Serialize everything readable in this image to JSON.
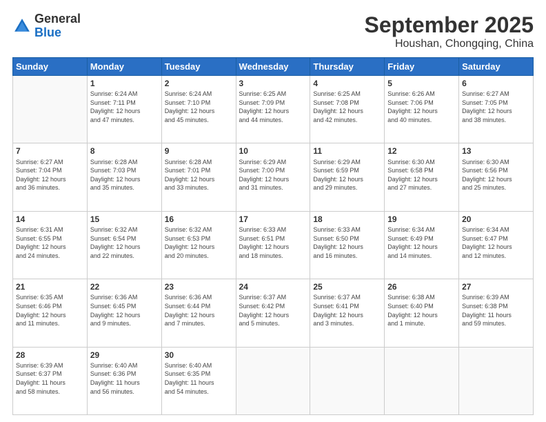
{
  "header": {
    "logo_line1": "General",
    "logo_line2": "Blue",
    "month": "September 2025",
    "location": "Houshan, Chongqing, China"
  },
  "weekdays": [
    "Sunday",
    "Monday",
    "Tuesday",
    "Wednesday",
    "Thursday",
    "Friday",
    "Saturday"
  ],
  "weeks": [
    [
      {
        "day": "",
        "info": ""
      },
      {
        "day": "1",
        "info": "Sunrise: 6:24 AM\nSunset: 7:11 PM\nDaylight: 12 hours\nand 47 minutes."
      },
      {
        "day": "2",
        "info": "Sunrise: 6:24 AM\nSunset: 7:10 PM\nDaylight: 12 hours\nand 45 minutes."
      },
      {
        "day": "3",
        "info": "Sunrise: 6:25 AM\nSunset: 7:09 PM\nDaylight: 12 hours\nand 44 minutes."
      },
      {
        "day": "4",
        "info": "Sunrise: 6:25 AM\nSunset: 7:08 PM\nDaylight: 12 hours\nand 42 minutes."
      },
      {
        "day": "5",
        "info": "Sunrise: 6:26 AM\nSunset: 7:06 PM\nDaylight: 12 hours\nand 40 minutes."
      },
      {
        "day": "6",
        "info": "Sunrise: 6:27 AM\nSunset: 7:05 PM\nDaylight: 12 hours\nand 38 minutes."
      }
    ],
    [
      {
        "day": "7",
        "info": "Sunrise: 6:27 AM\nSunset: 7:04 PM\nDaylight: 12 hours\nand 36 minutes."
      },
      {
        "day": "8",
        "info": "Sunrise: 6:28 AM\nSunset: 7:03 PM\nDaylight: 12 hours\nand 35 minutes."
      },
      {
        "day": "9",
        "info": "Sunrise: 6:28 AM\nSunset: 7:01 PM\nDaylight: 12 hours\nand 33 minutes."
      },
      {
        "day": "10",
        "info": "Sunrise: 6:29 AM\nSunset: 7:00 PM\nDaylight: 12 hours\nand 31 minutes."
      },
      {
        "day": "11",
        "info": "Sunrise: 6:29 AM\nSunset: 6:59 PM\nDaylight: 12 hours\nand 29 minutes."
      },
      {
        "day": "12",
        "info": "Sunrise: 6:30 AM\nSunset: 6:58 PM\nDaylight: 12 hours\nand 27 minutes."
      },
      {
        "day": "13",
        "info": "Sunrise: 6:30 AM\nSunset: 6:56 PM\nDaylight: 12 hours\nand 25 minutes."
      }
    ],
    [
      {
        "day": "14",
        "info": "Sunrise: 6:31 AM\nSunset: 6:55 PM\nDaylight: 12 hours\nand 24 minutes."
      },
      {
        "day": "15",
        "info": "Sunrise: 6:32 AM\nSunset: 6:54 PM\nDaylight: 12 hours\nand 22 minutes."
      },
      {
        "day": "16",
        "info": "Sunrise: 6:32 AM\nSunset: 6:53 PM\nDaylight: 12 hours\nand 20 minutes."
      },
      {
        "day": "17",
        "info": "Sunrise: 6:33 AM\nSunset: 6:51 PM\nDaylight: 12 hours\nand 18 minutes."
      },
      {
        "day": "18",
        "info": "Sunrise: 6:33 AM\nSunset: 6:50 PM\nDaylight: 12 hours\nand 16 minutes."
      },
      {
        "day": "19",
        "info": "Sunrise: 6:34 AM\nSunset: 6:49 PM\nDaylight: 12 hours\nand 14 minutes."
      },
      {
        "day": "20",
        "info": "Sunrise: 6:34 AM\nSunset: 6:47 PM\nDaylight: 12 hours\nand 12 minutes."
      }
    ],
    [
      {
        "day": "21",
        "info": "Sunrise: 6:35 AM\nSunset: 6:46 PM\nDaylight: 12 hours\nand 11 minutes."
      },
      {
        "day": "22",
        "info": "Sunrise: 6:36 AM\nSunset: 6:45 PM\nDaylight: 12 hours\nand 9 minutes."
      },
      {
        "day": "23",
        "info": "Sunrise: 6:36 AM\nSunset: 6:44 PM\nDaylight: 12 hours\nand 7 minutes."
      },
      {
        "day": "24",
        "info": "Sunrise: 6:37 AM\nSunset: 6:42 PM\nDaylight: 12 hours\nand 5 minutes."
      },
      {
        "day": "25",
        "info": "Sunrise: 6:37 AM\nSunset: 6:41 PM\nDaylight: 12 hours\nand 3 minutes."
      },
      {
        "day": "26",
        "info": "Sunrise: 6:38 AM\nSunset: 6:40 PM\nDaylight: 12 hours\nand 1 minute."
      },
      {
        "day": "27",
        "info": "Sunrise: 6:39 AM\nSunset: 6:38 PM\nDaylight: 11 hours\nand 59 minutes."
      }
    ],
    [
      {
        "day": "28",
        "info": "Sunrise: 6:39 AM\nSunset: 6:37 PM\nDaylight: 11 hours\nand 58 minutes."
      },
      {
        "day": "29",
        "info": "Sunrise: 6:40 AM\nSunset: 6:36 PM\nDaylight: 11 hours\nand 56 minutes."
      },
      {
        "day": "30",
        "info": "Sunrise: 6:40 AM\nSunset: 6:35 PM\nDaylight: 11 hours\nand 54 minutes."
      },
      {
        "day": "",
        "info": ""
      },
      {
        "day": "",
        "info": ""
      },
      {
        "day": "",
        "info": ""
      },
      {
        "day": "",
        "info": ""
      }
    ]
  ]
}
